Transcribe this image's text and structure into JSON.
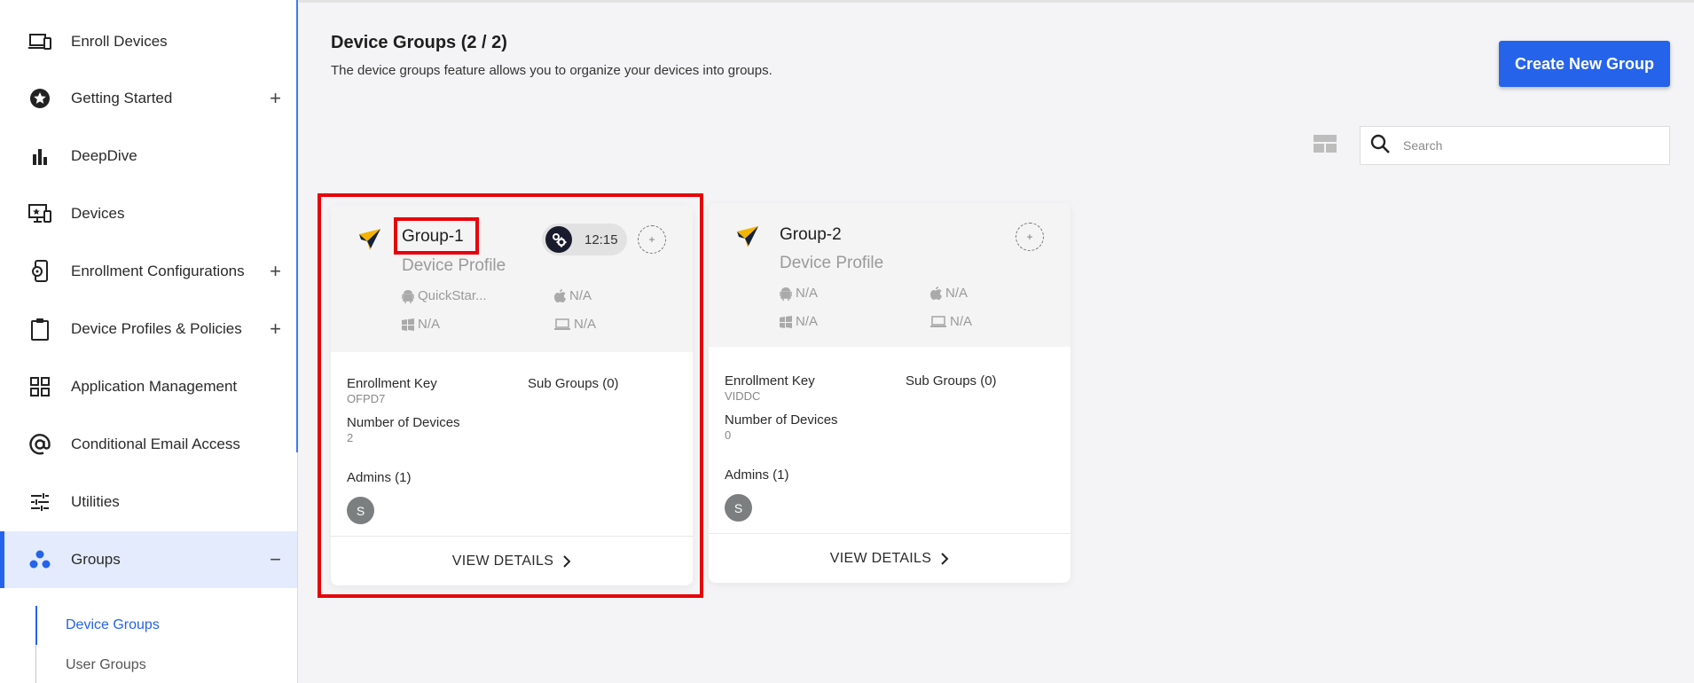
{
  "sidebar": {
    "items": [
      {
        "label": "Enroll Devices",
        "icon": "devices-icon"
      },
      {
        "label": "Getting Started",
        "icon": "star-icon",
        "expand": "+"
      },
      {
        "label": "DeepDive",
        "icon": "bar-chart-icon"
      },
      {
        "label": "Devices",
        "icon": "monitor-icon"
      },
      {
        "label": "Enrollment Configurations",
        "icon": "phone-settings-icon",
        "expand": "+"
      },
      {
        "label": "Device Profiles & Policies",
        "icon": "clipboard-icon",
        "expand": "+"
      },
      {
        "label": "Application Management",
        "icon": "grid-icon"
      },
      {
        "label": "Conditional Email Access",
        "icon": "at-icon"
      },
      {
        "label": "Utilities",
        "icon": "sliders-icon"
      },
      {
        "label": "Groups",
        "icon": "groups-icon",
        "expand": "−"
      }
    ],
    "subitems": [
      {
        "label": "Device Groups"
      },
      {
        "label": "User Groups"
      }
    ]
  },
  "page": {
    "title": "Device Groups (2 / 2)",
    "description": "The device groups feature allows you to organize your devices into groups.",
    "create_button": "Create New Group",
    "search_placeholder": "Search"
  },
  "cards": [
    {
      "name": "Group-1",
      "profile_label": "Device Profile",
      "timer": "12:15",
      "android": "QuickStar...",
      "apple": "N/A",
      "windows": "N/A",
      "laptop": "N/A",
      "enrollment_key_label": "Enrollment Key",
      "enrollment_key": "OFPD7",
      "sub_groups": "Sub Groups (0)",
      "num_devices_label": "Number of Devices",
      "num_devices": "2",
      "admins": "Admins (1)",
      "admin_avatar": "S",
      "plus": "+",
      "view_details": "VIEW DETAILS"
    },
    {
      "name": "Group-2",
      "profile_label": "Device Profile",
      "android": "N/A",
      "apple": "N/A",
      "windows": "N/A",
      "laptop": "N/A",
      "enrollment_key_label": "Enrollment Key",
      "enrollment_key": "VIDDC",
      "sub_groups": "Sub Groups (0)",
      "num_devices_label": "Number of Devices",
      "num_devices": "0",
      "admins": "Admins (1)",
      "admin_avatar": "S",
      "plus": "+",
      "view_details": "VIEW DETAILS"
    }
  ],
  "colors": {
    "accent": "#2563eb",
    "highlight": "#e8000b",
    "active_bg": "#e3ebfc"
  }
}
